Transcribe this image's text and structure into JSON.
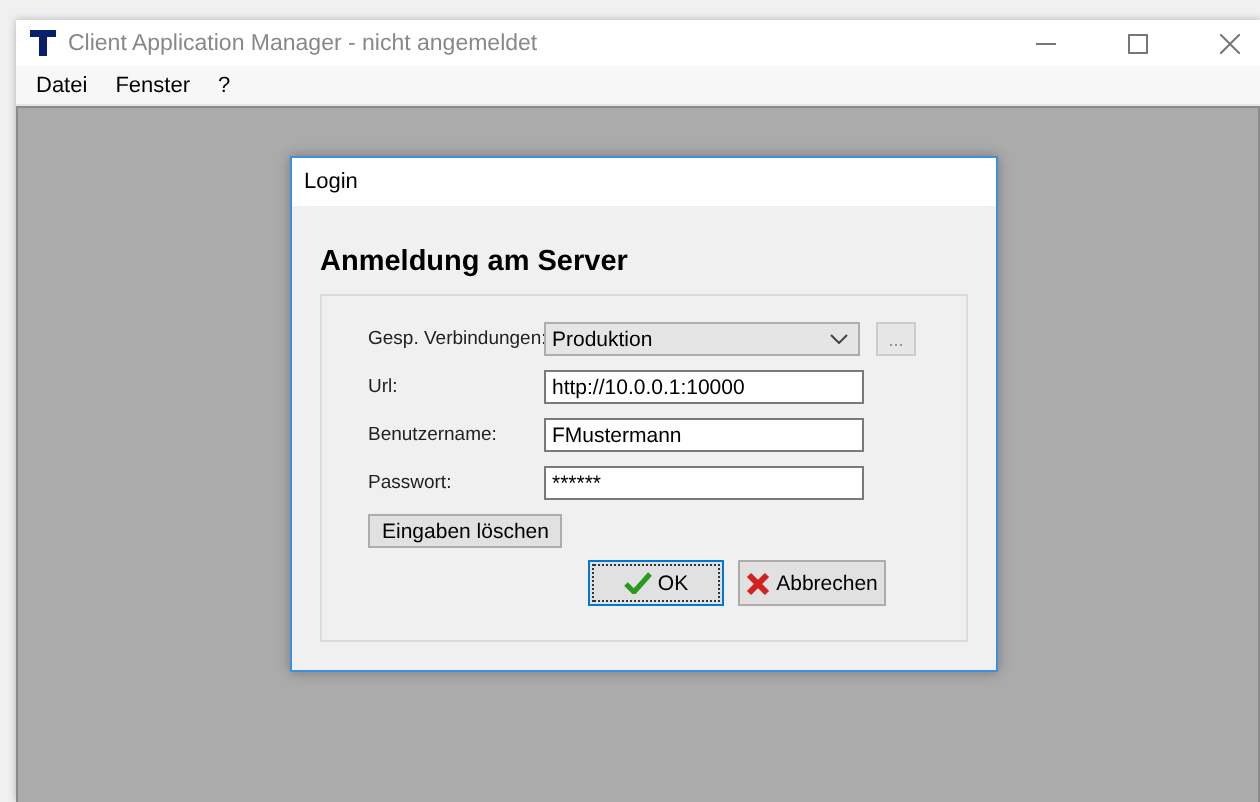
{
  "window": {
    "title": "Client Application Manager - nicht angemeldet"
  },
  "menu": [
    "Datei",
    "Fenster",
    "?"
  ],
  "dialog": {
    "title": "Login",
    "heading": "Anmeldung am Server",
    "fields": [
      {
        "kind": "select",
        "label": "Gesp. Verbindungen:",
        "value": "Produktion",
        "extra": "..."
      },
      {
        "kind": "text",
        "label": "Url:",
        "value": "http://10.0.0.1:10000"
      },
      {
        "kind": "text",
        "label": "Benutzername:",
        "value": "FMustermann"
      },
      {
        "kind": "text",
        "label": "Passwort:",
        "value": "******"
      }
    ],
    "clear_button": "Eingaben löschen",
    "ok_button": "OK",
    "cancel_button": "Abbrechen"
  }
}
